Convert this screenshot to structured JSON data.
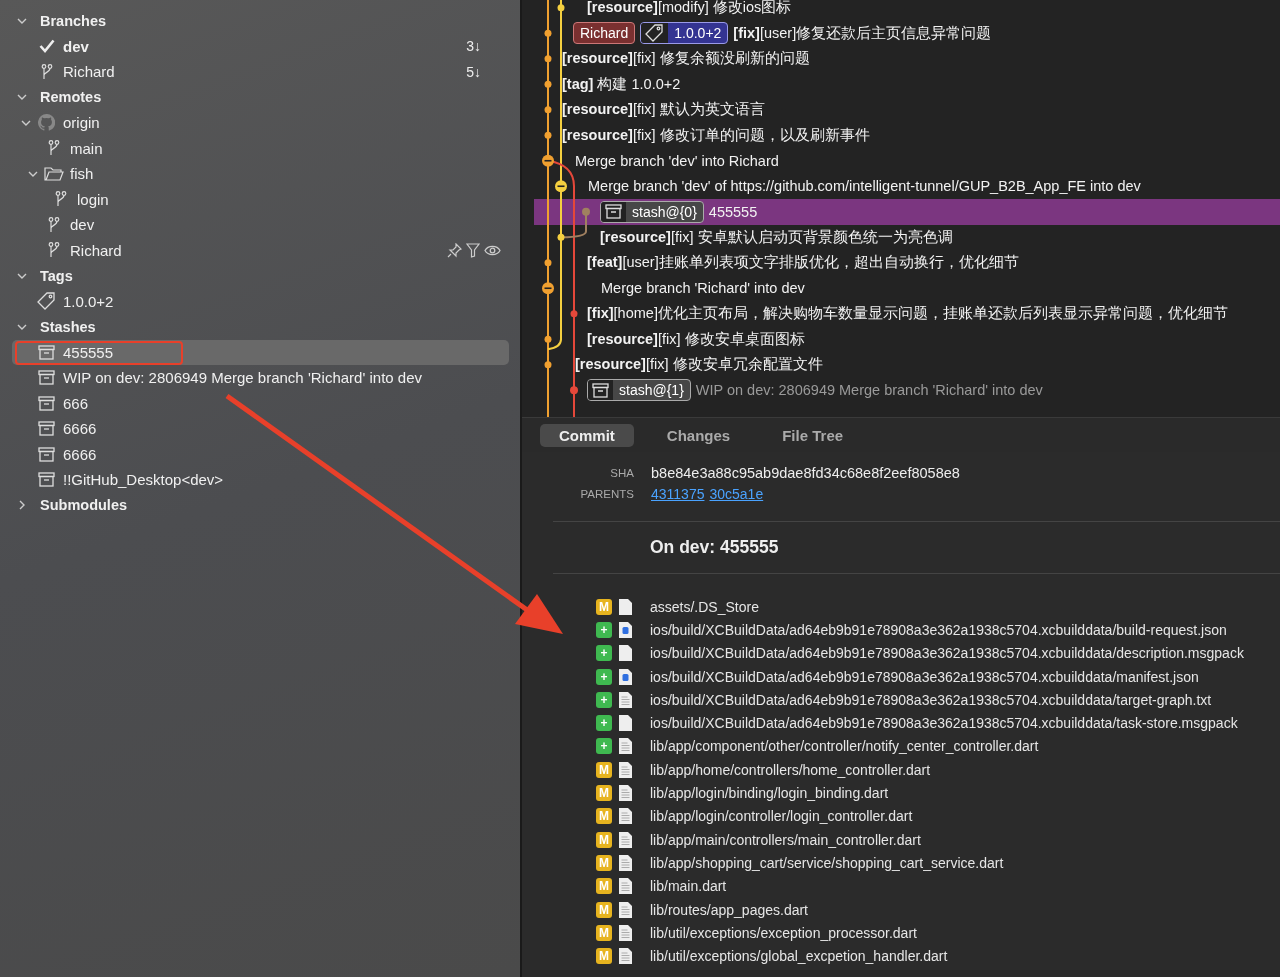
{
  "sidebar": {
    "sections": [
      {
        "title": "Branches",
        "expanded": true,
        "items": [
          {
            "kind": "branch",
            "name": "dev",
            "current": true,
            "count": "3↓"
          },
          {
            "kind": "branch",
            "name": "Richard",
            "current": false,
            "count": "5↓"
          }
        ]
      },
      {
        "title": "Remotes",
        "expanded": true,
        "items": [
          {
            "kind": "remote",
            "name": "origin",
            "expanded": true,
            "children": [
              {
                "kind": "branch",
                "name": "main",
                "hovered": false
              },
              {
                "kind": "folder",
                "name": "fish",
                "expanded": true,
                "hovered": false,
                "children": [
                  {
                    "kind": "branch",
                    "name": "login"
                  }
                ]
              },
              {
                "kind": "branch",
                "name": "dev",
                "hovered": false
              },
              {
                "kind": "branch",
                "name": "Richard",
                "hovered": true
              }
            ]
          }
        ]
      },
      {
        "title": "Tags",
        "expanded": true,
        "items": [
          {
            "kind": "tag",
            "name": "1.0.0+2"
          }
        ]
      },
      {
        "title": "Stashes",
        "expanded": true,
        "items": [
          {
            "kind": "stash",
            "name": "455555",
            "selected": true
          },
          {
            "kind": "stash",
            "name": "WIP on dev: 2806949 Merge branch 'Richard' into dev",
            "selected": false
          },
          {
            "kind": "stash",
            "name": "666",
            "selected": false
          },
          {
            "kind": "stash",
            "name": "6666",
            "selected": false
          },
          {
            "kind": "stash",
            "name": "6666",
            "selected": false
          },
          {
            "kind": "stash",
            "name": "!!GitHub_Desktop<dev>",
            "selected": false
          }
        ]
      },
      {
        "title": "Submodules",
        "expanded": false
      }
    ]
  },
  "graph": {
    "rows": [
      {
        "kind": "commit",
        "selected": false,
        "message": "**[resource]**[modify] 修改ios图标"
      },
      {
        "kind": "commit",
        "selected": false,
        "refs": [
          {
            "kind": "branch",
            "label": "Richard"
          },
          {
            "kind": "tag",
            "label": "1.0.0+2"
          }
        ],
        "message": "**[fix]**[user]修复还款后主页信息异常问题"
      },
      {
        "kind": "commit",
        "selected": false,
        "message": "**[resource]**[fix] 修复余额没刷新的问题"
      },
      {
        "kind": "commit",
        "selected": false,
        "message": "**[tag]** 构建 1.0.0+2"
      },
      {
        "kind": "commit",
        "selected": false,
        "message": "**[resource]**[fix] 默认为英文语言"
      },
      {
        "kind": "commit",
        "selected": false,
        "message": "**[resource]**[fix] 修改订单的问题，以及刷新事件"
      },
      {
        "kind": "merge",
        "selected": false,
        "message": "Merge branch 'dev' into Richard"
      },
      {
        "kind": "merge",
        "selected": false,
        "message": "Merge branch 'dev' of https://github.com/intelligent-tunnel/GUP_B2B_App_FE into dev"
      },
      {
        "kind": "stash",
        "selected": true,
        "refs": [
          {
            "kind": "stash",
            "label": "stash@{0}"
          }
        ],
        "message": "455555"
      },
      {
        "kind": "commit",
        "selected": false,
        "message": "**[resource]**[fix] 安卓默认启动页背景颜色统一为亮色调"
      },
      {
        "kind": "commit",
        "selected": false,
        "message": "**[feat]**[user]挂账单列表项文字排版优化，超出自动换行，优化细节"
      },
      {
        "kind": "merge",
        "selected": false,
        "message": "Merge branch 'Richard' into dev"
      },
      {
        "kind": "commit",
        "selected": false,
        "message": "**[fix]**[home]优化主页布局，解决购物车数量显示问题，挂账单还款后列表显示异常问题，优化细节"
      },
      {
        "kind": "commit",
        "selected": false,
        "message": "**[resource]**[fix] 修改安卓桌面图标"
      },
      {
        "kind": "commit",
        "selected": false,
        "message": "**[resource]**[fix] 修改安卓冗余配置文件"
      },
      {
        "kind": "stash",
        "selected": false,
        "refs": [
          {
            "kind": "stash",
            "label": "stash@{1}"
          }
        ],
        "message": "WIP on dev: 2806949 Merge branch 'Richard' into dev"
      }
    ]
  },
  "tabs": [
    {
      "label": "Commit",
      "selected": true
    },
    {
      "label": "Changes",
      "selected": false
    },
    {
      "label": "File Tree",
      "selected": false
    }
  ],
  "details": {
    "sha_label": "SHA",
    "sha": "b8e84e3a88c95ab9dae8fd34c68e8f2eef8058e8",
    "parents_label": "PARENTS",
    "parents": [
      "4311375",
      "30c5a1e"
    ],
    "title": "On dev: 455555",
    "files": [
      {
        "color": "#e7b41f",
        "badge": "M",
        "kind": "blank",
        "path": "assets/.DS_Store"
      },
      {
        "color": "#3fb950",
        "badge": "+",
        "kind": "json",
        "path": "ios/build/XCBuildData/ad64eb9b91e78908a3e362a1938c5704.xcbuilddata/build-request.json"
      },
      {
        "color": "#3fb950",
        "badge": "+",
        "kind": "blank",
        "path": "ios/build/XCBuildData/ad64eb9b91e78908a3e362a1938c5704.xcbuilddata/description.msgpack"
      },
      {
        "color": "#3fb950",
        "badge": "+",
        "kind": "json",
        "path": "ios/build/XCBuildData/ad64eb9b91e78908a3e362a1938c5704.xcbuilddata/manifest.json"
      },
      {
        "color": "#3fb950",
        "badge": "+",
        "kind": "text",
        "path": "ios/build/XCBuildData/ad64eb9b91e78908a3e362a1938c5704.xcbuilddata/target-graph.txt"
      },
      {
        "color": "#3fb950",
        "badge": "+",
        "kind": "blank",
        "path": "ios/build/XCBuildData/ad64eb9b91e78908a3e362a1938c5704.xcbuilddata/task-store.msgpack"
      },
      {
        "color": "#3fb950",
        "badge": "+",
        "kind": "text",
        "path": "lib/app/component/other/controller/notify_center_controller.dart"
      },
      {
        "color": "#e7b41f",
        "badge": "M",
        "kind": "text",
        "path": "lib/app/home/controllers/home_controller.dart"
      },
      {
        "color": "#e7b41f",
        "badge": "M",
        "kind": "text",
        "path": "lib/app/login/binding/login_binding.dart"
      },
      {
        "color": "#e7b41f",
        "badge": "M",
        "kind": "text",
        "path": "lib/app/login/controller/login_controller.dart"
      },
      {
        "color": "#e7b41f",
        "badge": "M",
        "kind": "text",
        "path": "lib/app/main/controllers/main_controller.dart"
      },
      {
        "color": "#e7b41f",
        "badge": "M",
        "kind": "text",
        "path": "lib/app/shopping_cart/service/shopping_cart_service.dart"
      },
      {
        "color": "#e7b41f",
        "badge": "M",
        "kind": "text",
        "path": "lib/main.dart"
      },
      {
        "color": "#e7b41f",
        "badge": "M",
        "kind": "text",
        "path": "lib/routes/app_pages.dart"
      },
      {
        "color": "#e7b41f",
        "badge": "M",
        "kind": "text",
        "path": "lib/util/exceptions/exception_processor.dart"
      },
      {
        "color": "#e7b41f",
        "badge": "M",
        "kind": "text",
        "path": "lib/util/exceptions/global_excpetion_handler.dart"
      }
    ]
  }
}
